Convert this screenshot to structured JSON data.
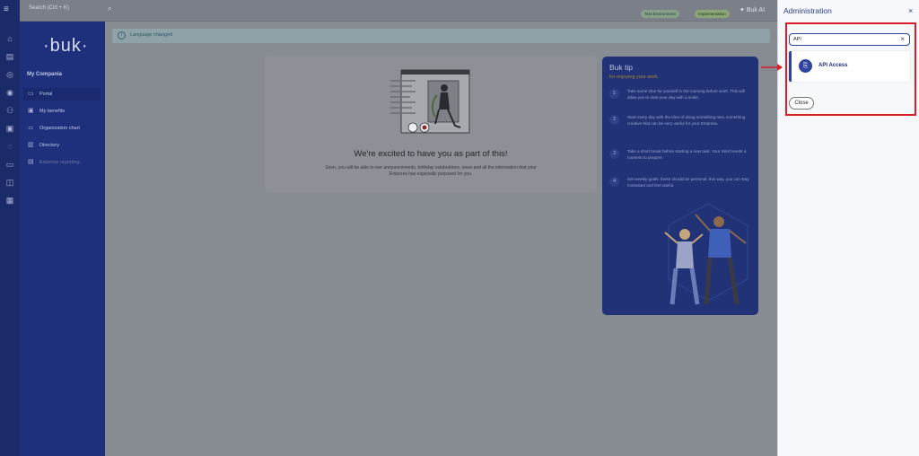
{
  "topbar": {
    "menu_icon": "hamburger-icon",
    "search_placeholder": "Search (Ctrl + K)",
    "env_badge": "Test Environment",
    "impl_badge": "Implementation",
    "buk_ai": "Buk AI"
  },
  "rail": {
    "icons": [
      "home-icon",
      "document-icon",
      "money-icon",
      "target-icon",
      "org-icon",
      "briefcase-icon",
      "eye-icon",
      "folder-icon",
      "camera-icon",
      "grid-icon"
    ]
  },
  "nav": {
    "logo": "·buk·",
    "section": "My Compania",
    "items": [
      {
        "label": "Portal",
        "icon": "monitor-icon"
      },
      {
        "label": "My benefits",
        "icon": "gift-icon"
      },
      {
        "label": "Organization chart",
        "icon": "sitemap-icon"
      },
      {
        "label": "Directory",
        "icon": "book-icon"
      },
      {
        "label": "Expense reporting",
        "icon": "receipt-icon"
      }
    ]
  },
  "alert": {
    "text": "Language changed"
  },
  "welcome": {
    "title": "We're excited to have you as part of this!",
    "body": "Soon, you will be able to see announcements, birthday celebrations, news and all the information that your Empresa has especially prepared for you."
  },
  "tip": {
    "title": "Buk tip",
    "subtitle": "for enjoying your work",
    "steps": [
      {
        "num": "1",
        "text": "Take some time for yourself in the morning before work. This will allow you to start your day with a smile."
      },
      {
        "num": "2",
        "text": "Start every day with the idea of doing something new, something creative that can be very useful for your Empresa."
      },
      {
        "num": "3",
        "text": "Take a short break before starting a new task. Your mind needs a moment to prepare."
      },
      {
        "num": "4",
        "text": "Set weekly goals: these should be personal; this way, you can stay motivated and feel useful."
      }
    ]
  },
  "panel": {
    "title": "Administration",
    "search_value": "API",
    "result_label": "API Access",
    "close_button": "Close"
  },
  "colors": {
    "accent": "#2f43a0",
    "nav_bg": "#1e2f7b",
    "highlight": "#d81f26"
  }
}
